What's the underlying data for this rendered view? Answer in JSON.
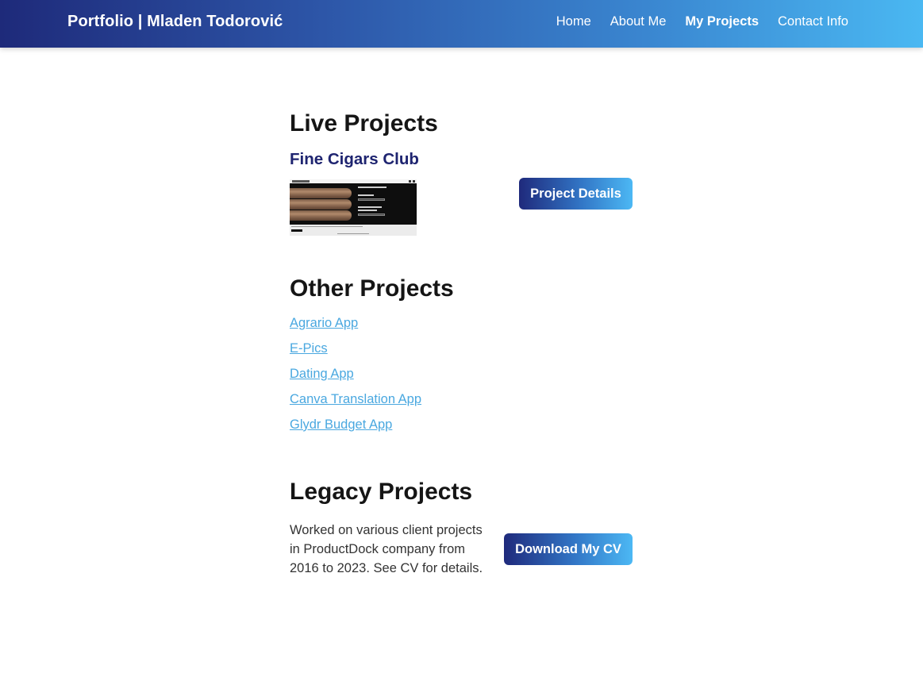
{
  "header": {
    "brand": "Portfolio | Mladen Todorović",
    "nav": [
      {
        "label": "Home",
        "active": false
      },
      {
        "label": "About Me",
        "active": false
      },
      {
        "label": "My Projects",
        "active": true
      },
      {
        "label": "Contact Info",
        "active": false
      }
    ]
  },
  "live": {
    "title": "Live Projects",
    "project": {
      "name": "Fine Cigars Club",
      "button_label": "Project Details"
    }
  },
  "other": {
    "title": "Other Projects",
    "links": [
      "Agrario App",
      "E-Pics",
      "Dating App",
      "Canva Translation App",
      "Glydr Budget App"
    ]
  },
  "legacy": {
    "title": "Legacy Projects",
    "text": "Worked on various client projects in ProductDock company from 2016 to 2023. See CV for details.",
    "button_label": "Download My CV"
  },
  "colors": {
    "nav_gradient_start": "#1e2a7a",
    "nav_gradient_end": "#4ab8f2",
    "project_name": "#1e2470",
    "link": "#4aa8e0"
  }
}
